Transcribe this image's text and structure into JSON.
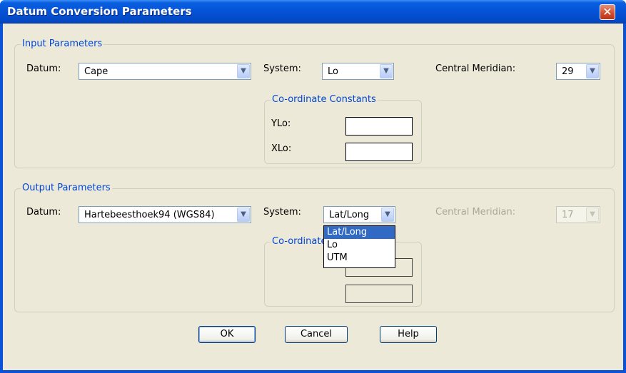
{
  "window": {
    "title": "Datum Conversion Parameters",
    "close_symbol": "✕"
  },
  "input": {
    "group_title": "Input Parameters",
    "datum_label": "Datum:",
    "datum_value": "Cape",
    "system_label": "System:",
    "system_value": "Lo",
    "central_meridian_label": "Central Meridian:",
    "central_meridian_value": "29",
    "constants": {
      "group_title": "Co-ordinate Constants",
      "ylo_label": "YLo:",
      "xlo_label": "XLo:",
      "ylo_value": "",
      "xlo_value": ""
    }
  },
  "output": {
    "group_title": "Output Parameters",
    "datum_label": "Datum:",
    "datum_value": "Hartebeesthoek94 (WGS84)",
    "system_label": "System:",
    "system_value": "Lat/Long",
    "system_options": [
      "Lat/Long",
      "Lo",
      "UTM"
    ],
    "system_selected_option": "Lat/Long",
    "central_meridian_label": "Central Meridian:",
    "central_meridian_value": "17",
    "constants": {
      "group_title_visible": "Co-ordinate"
    }
  },
  "buttons": {
    "ok": "OK",
    "cancel": "Cancel",
    "help": "Help"
  },
  "colors": {
    "title_bar": "#0452d6",
    "group_title": "#0046d5",
    "selection": "#316ac5",
    "dialog_bg": "#ece9d8"
  },
  "icons": {
    "dropdown": "chevron-down-icon",
    "close": "close-icon"
  }
}
